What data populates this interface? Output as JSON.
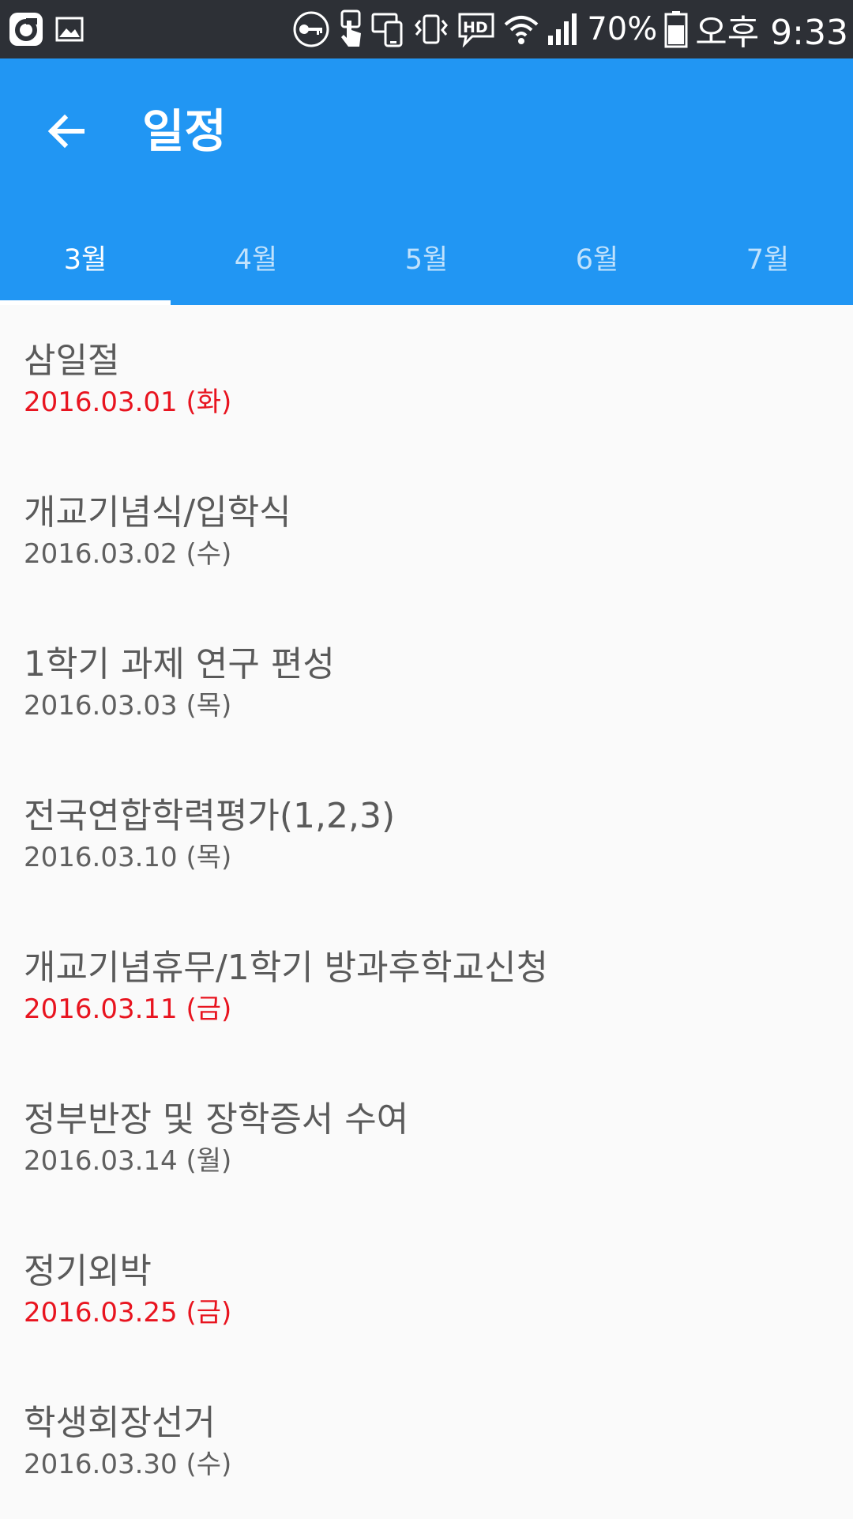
{
  "status_bar": {
    "battery_percent": "70%",
    "time": "오후 9:33",
    "icons": [
      "o-app-icon",
      "image-icon",
      "key-icon",
      "touch-icon",
      "device-sync-icon",
      "vibrate-icon",
      "hd-voice-icon",
      "wifi-icon",
      "signal-icon",
      "battery-icon"
    ]
  },
  "header": {
    "title": "일정",
    "back_icon": "arrow-back-icon",
    "accent_color": "#2196f3"
  },
  "tabs": [
    {
      "label": "3월",
      "active": true
    },
    {
      "label": "4월",
      "active": false
    },
    {
      "label": "5월",
      "active": false
    },
    {
      "label": "6월",
      "active": false
    },
    {
      "label": "7월",
      "active": false
    }
  ],
  "events": [
    {
      "title": "삼일절",
      "date": "2016.03.01 (화)",
      "holiday": true
    },
    {
      "title": "개교기념식/입학식",
      "date": "2016.03.02 (수)",
      "holiday": false
    },
    {
      "title": "1학기 과제 연구 편성",
      "date": "2016.03.03 (목)",
      "holiday": false
    },
    {
      "title": "전국연합학력평가(1,2,3)",
      "date": "2016.03.10 (목)",
      "holiday": false
    },
    {
      "title": "개교기념휴무/1학기 방과후학교신청",
      "date": "2016.03.11 (금)",
      "holiday": true
    },
    {
      "title": "정부반장 및 장학증서 수여",
      "date": "2016.03.14 (월)",
      "holiday": false
    },
    {
      "title": "정기외박",
      "date": "2016.03.25 (금)",
      "holiday": true
    },
    {
      "title": "학생회장선거",
      "date": "2016.03.30 (수)",
      "holiday": false
    }
  ],
  "colors": {
    "holiday_date": "#e8141f",
    "normal_date": "#606060",
    "title_text": "#5a5a5a"
  }
}
